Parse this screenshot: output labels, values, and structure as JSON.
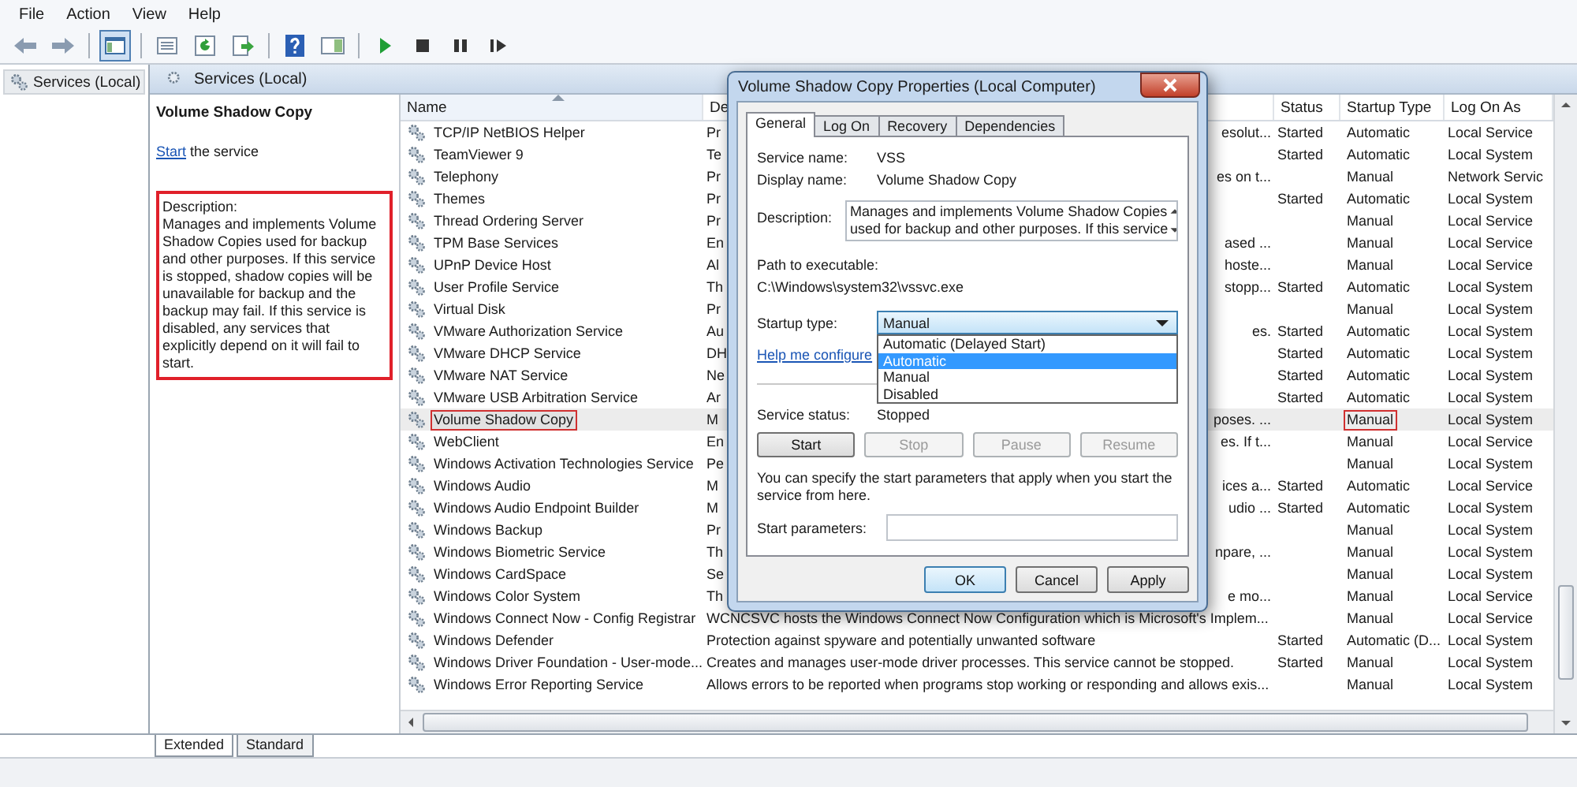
{
  "menu": [
    {
      "label": "File"
    },
    {
      "label": "Action"
    },
    {
      "label": "View"
    },
    {
      "label": "Help"
    }
  ],
  "toolbar": [
    {
      "kind": "back",
      "pressed": false
    },
    {
      "kind": "forward",
      "pressed": false
    },
    {
      "kind": "separator"
    },
    {
      "kind": "console",
      "pressed": true
    },
    {
      "kind": "separator"
    },
    {
      "kind": "list",
      "pressed": false
    },
    {
      "kind": "refresh",
      "pressed": false
    },
    {
      "kind": "export",
      "pressed": false
    },
    {
      "kind": "separator"
    },
    {
      "kind": "help",
      "pressed": false
    },
    {
      "kind": "panel",
      "pressed": false
    },
    {
      "kind": "separator"
    },
    {
      "kind": "play",
      "pressed": false
    },
    {
      "kind": "stop",
      "pressed": false
    },
    {
      "kind": "pause",
      "pressed": false
    },
    {
      "kind": "resume",
      "pressed": false
    }
  ],
  "tree": [
    {
      "label": "Services (Local)",
      "selected": true
    }
  ],
  "pane_title": "Services (Local)",
  "details": {
    "title": "Volume Shadow Copy",
    "action_link": "Start",
    "action_text": " the service",
    "description_label": "Description:",
    "description": "Manages and implements Volume Shadow Copies used for backup and other purposes. If this service is stopped, shadow copies will be unavailable for backup and the backup may fail. If this service is disabled, any services that explicitly depend on it will fail to start.",
    "marked": true
  },
  "table": {
    "columns": [
      {
        "label": "Name",
        "sorted": true
      },
      {
        "label": "De",
        "sorted": false
      },
      {
        "label": "Status",
        "sorted": false
      },
      {
        "label": "Startup Type",
        "sorted": false
      },
      {
        "label": "Log On As",
        "sorted": false
      }
    ],
    "rows": [
      {
        "name": "TCP/IP NetBIOS Helper",
        "desc_start": "Pr",
        "desc_end": "esolut...",
        "status": "Started",
        "startup": "Automatic",
        "logon": "Local Service",
        "selected": false,
        "marked": false
      },
      {
        "name": "TeamViewer 9",
        "desc_start": "Te",
        "status": "Started",
        "startup": "Automatic",
        "logon": "Local System",
        "selected": false,
        "marked": false
      },
      {
        "name": "Telephony",
        "desc_start": "Pr",
        "desc_end": "es on t...",
        "startup": "Manual",
        "logon": "Network Servic",
        "selected": false,
        "marked": false
      },
      {
        "name": "Themes",
        "desc_start": "Pr",
        "status": "Started",
        "startup": "Automatic",
        "logon": "Local System",
        "selected": false,
        "marked": false
      },
      {
        "name": "Thread Ordering Server",
        "desc_start": "Pr",
        "startup": "Manual",
        "logon": "Local Service",
        "selected": false,
        "marked": false
      },
      {
        "name": "TPM Base Services",
        "desc_start": "En",
        "desc_end": "ased ...",
        "startup": "Manual",
        "logon": "Local Service",
        "selected": false,
        "marked": false
      },
      {
        "name": "UPnP Device Host",
        "desc_start": "Al",
        "desc_end": "hoste...",
        "startup": "Manual",
        "logon": "Local Service",
        "selected": false,
        "marked": false
      },
      {
        "name": "User Profile Service",
        "desc_start": "Th",
        "desc_end": "stopp...",
        "status": "Started",
        "startup": "Automatic",
        "logon": "Local System",
        "selected": false,
        "marked": false
      },
      {
        "name": "Virtual Disk",
        "desc_start": "Pr",
        "startup": "Manual",
        "logon": "Local System",
        "selected": false,
        "marked": false
      },
      {
        "name": "VMware Authorization Service",
        "desc_start": "Au",
        "desc_end": "es.",
        "status": "Started",
        "startup": "Automatic",
        "logon": "Local System",
        "selected": false,
        "marked": false
      },
      {
        "name": "VMware DHCP Service",
        "desc_start": "DH",
        "status": "Started",
        "startup": "Automatic",
        "logon": "Local System",
        "selected": false,
        "marked": false
      },
      {
        "name": "VMware NAT Service",
        "desc_start": "Ne",
        "status": "Started",
        "startup": "Automatic",
        "logon": "Local System",
        "selected": false,
        "marked": false
      },
      {
        "name": "VMware USB Arbitration Service",
        "desc_start": "Ar",
        "status": "Started",
        "startup": "Automatic",
        "logon": "Local System",
        "selected": false,
        "marked": false
      },
      {
        "name": "Volume Shadow Copy",
        "desc_start": "M",
        "desc_end": "poses. ...",
        "startup": "Manual",
        "logon": "Local System",
        "selected": true,
        "marked": true
      },
      {
        "name": "WebClient",
        "desc_start": "En",
        "desc_end": "es. If t...",
        "startup": "Manual",
        "logon": "Local Service",
        "selected": false,
        "marked": false
      },
      {
        "name": "Windows Activation Technologies Service",
        "desc_start": "Pe",
        "startup": "Manual",
        "logon": "Local System",
        "selected": false,
        "marked": false
      },
      {
        "name": "Windows Audio",
        "desc_start": "M",
        "desc_end": "ices a...",
        "status": "Started",
        "startup": "Automatic",
        "logon": "Local Service",
        "selected": false,
        "marked": false
      },
      {
        "name": "Windows Audio Endpoint Builder",
        "desc_start": "M",
        "desc_end": "udio ...",
        "status": "Started",
        "startup": "Automatic",
        "logon": "Local System",
        "selected": false,
        "marked": false
      },
      {
        "name": "Windows Backup",
        "desc_start": "Pr",
        "startup": "Manual",
        "logon": "Local System",
        "selected": false,
        "marked": false
      },
      {
        "name": "Windows Biometric Service",
        "desc_start": "Th",
        "desc_end": "npare, ...",
        "startup": "Manual",
        "logon": "Local System",
        "selected": false,
        "marked": false
      },
      {
        "name": "Windows CardSpace",
        "desc_start": "Se",
        "startup": "Manual",
        "logon": "Local System",
        "selected": false,
        "marked": false
      },
      {
        "name": "Windows Color System",
        "desc_start": "Th",
        "desc_end": "e mo...",
        "startup": "Manual",
        "logon": "Local Service",
        "selected": false,
        "marked": false
      },
      {
        "name": "Windows Connect Now - Config Registrar",
        "description": "WCNCSVC hosts the Windows Connect Now Configuration which is Microsoft's Implem...",
        "startup": "Manual",
        "logon": "Local Service",
        "selected": false,
        "marked": false
      },
      {
        "name": "Windows Defender",
        "description": "Protection against spyware and potentially unwanted software",
        "status": "Started",
        "startup": "Automatic (D...",
        "logon": "Local System",
        "selected": false,
        "marked": false
      },
      {
        "name": "Windows Driver Foundation - User-mode...",
        "description": "Creates and manages user-mode driver processes. This service cannot be stopped.",
        "status": "Started",
        "startup": "Manual",
        "logon": "Local System",
        "selected": false,
        "marked": false
      },
      {
        "name": "Windows Error Reporting Service",
        "description": "Allows errors to be reported when programs stop working or responding and allows exis...",
        "startup": "Manual",
        "logon": "Local System",
        "selected": false,
        "marked": false
      }
    ]
  },
  "view_tabs": [
    {
      "label": "Extended",
      "selected": true
    },
    {
      "label": "Standard",
      "selected": false
    }
  ],
  "dialog": {
    "title": "Volume Shadow Copy Properties (Local Computer)",
    "tabs": [
      {
        "label": "General",
        "selected": true
      },
      {
        "label": "Log On",
        "selected": false
      },
      {
        "label": "Recovery",
        "selected": false
      },
      {
        "label": "Dependencies",
        "selected": false
      }
    ],
    "fields": [
      {
        "label": "Service name:",
        "value": "VSS"
      },
      {
        "label": "Display name:",
        "value": "Volume Shadow Copy"
      }
    ],
    "description_label": "Description:",
    "description_lines": [
      "Manages and implements Volume Shadow Copies",
      "used for backup and other purposes. If this service"
    ],
    "path_label": "Path to executable:",
    "path": "C:\\Windows\\system32\\vssvc.exe",
    "startup_label": "Startup type:",
    "startup_value": "Manual",
    "dropdown_open": true,
    "startup_options": [
      {
        "label": "Automatic (Delayed Start)",
        "selected": false
      },
      {
        "label": "Automatic",
        "selected": true
      },
      {
        "label": "Manual",
        "selected": false
      },
      {
        "label": "Disabled",
        "selected": false
      }
    ],
    "help_link": "Help me configure",
    "status_label": "Service status:",
    "status_value": "Stopped",
    "control_buttons": [
      {
        "label": "Start",
        "disabled": false
      },
      {
        "label": "Stop",
        "disabled": true
      },
      {
        "label": "Pause",
        "disabled": true
      },
      {
        "label": "Resume",
        "disabled": true
      }
    ],
    "note": "You can specify the start parameters that apply when you start the service from here.",
    "params_label": "Start parameters:",
    "buttons": [
      {
        "label": "OK",
        "default": true
      },
      {
        "label": "Cancel",
        "default": false
      },
      {
        "label": "Apply",
        "default": false
      }
    ]
  }
}
